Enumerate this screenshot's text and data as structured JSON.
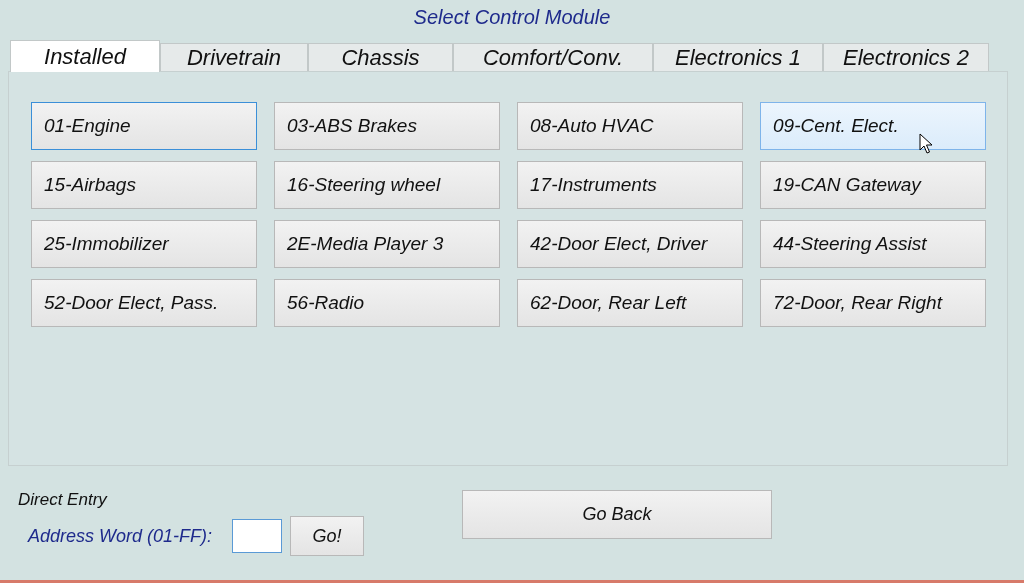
{
  "title": "Select Control Module",
  "tabs": [
    {
      "label": "Installed",
      "selected": true
    },
    {
      "label": "Drivetrain",
      "selected": false
    },
    {
      "label": "Chassis",
      "selected": false
    },
    {
      "label": "Comfort/Conv.",
      "selected": false
    },
    {
      "label": "Electronics 1",
      "selected": false
    },
    {
      "label": "Electronics 2",
      "selected": false
    }
  ],
  "modules": [
    {
      "label": "01-Engine",
      "focused": true,
      "hovered": false
    },
    {
      "label": "03-ABS Brakes",
      "focused": false,
      "hovered": false
    },
    {
      "label": "08-Auto HVAC",
      "focused": false,
      "hovered": false
    },
    {
      "label": "09-Cent. Elect.",
      "focused": false,
      "hovered": true
    },
    {
      "label": "15-Airbags",
      "focused": false,
      "hovered": false
    },
    {
      "label": "16-Steering wheel",
      "focused": false,
      "hovered": false
    },
    {
      "label": "17-Instruments",
      "focused": false,
      "hovered": false
    },
    {
      "label": "19-CAN Gateway",
      "focused": false,
      "hovered": false
    },
    {
      "label": "25-Immobilizer",
      "focused": false,
      "hovered": false
    },
    {
      "label": "2E-Media Player 3",
      "focused": false,
      "hovered": false
    },
    {
      "label": "42-Door Elect, Driver",
      "focused": false,
      "hovered": false
    },
    {
      "label": "44-Steering Assist",
      "focused": false,
      "hovered": false
    },
    {
      "label": "52-Door Elect, Pass.",
      "focused": false,
      "hovered": false
    },
    {
      "label": "56-Radio",
      "focused": false,
      "hovered": false
    },
    {
      "label": "62-Door, Rear Left",
      "focused": false,
      "hovered": false
    },
    {
      "label": "72-Door, Rear Right",
      "focused": false,
      "hovered": false
    }
  ],
  "direct_entry": {
    "heading": "Direct Entry",
    "label": "Address Word (01-FF):",
    "go_button": "Go!"
  },
  "back_button": "Go Back"
}
